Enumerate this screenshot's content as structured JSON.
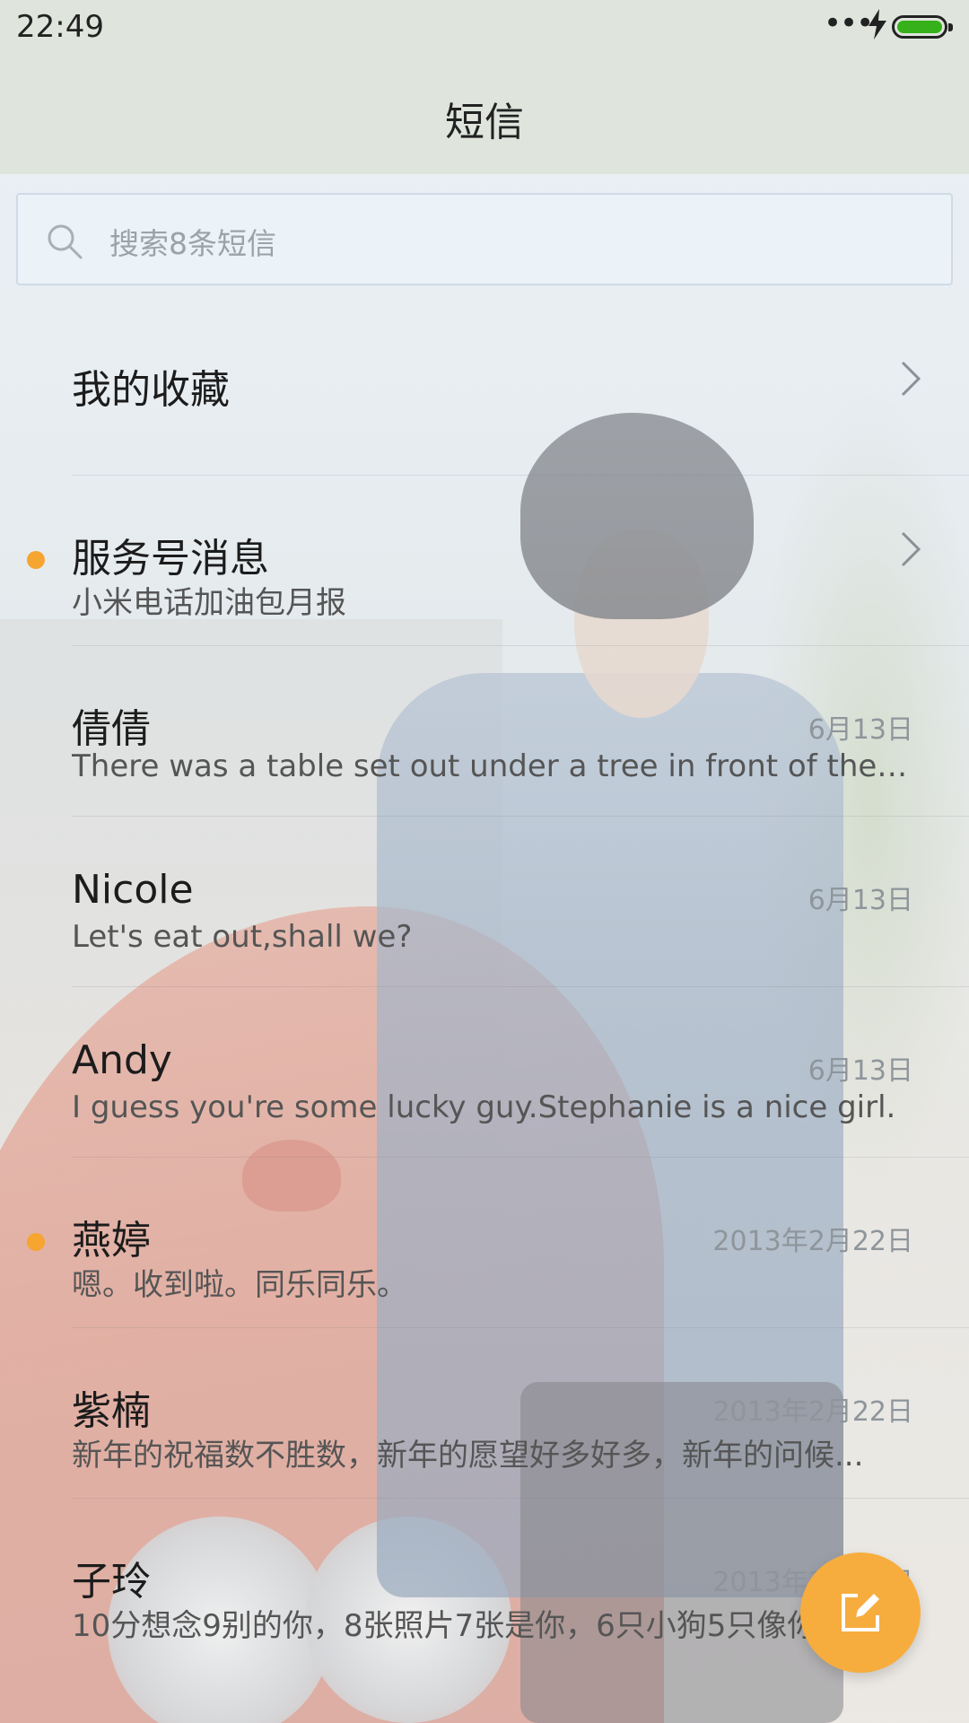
{
  "status_bar": {
    "time": "22:49",
    "signal_dots": "•••",
    "battery_color": "#36b11a"
  },
  "header": {
    "title": "短信"
  },
  "search": {
    "placeholder": "搜索8条短信"
  },
  "favorites": {
    "label": "我的收藏"
  },
  "conversations": [
    {
      "name": "服务号消息",
      "snippet": "小米电话加油包月报",
      "date": "",
      "unread": true,
      "chevron": true
    },
    {
      "name": "倩倩",
      "snippet": "There was a table set out under a tree in front of the ho...",
      "date": "6月13日",
      "unread": false
    },
    {
      "name": "Nicole",
      "snippet": "Let's eat out,shall we?",
      "date": "6月13日",
      "unread": false
    },
    {
      "name": "Andy",
      "snippet": "I guess you're some lucky guy.Stephanie is a nice girl.",
      "date": "6月13日",
      "unread": false
    },
    {
      "name": "燕婷",
      "snippet": "嗯。收到啦。同乐同乐。",
      "date": "2013年2月22日",
      "unread": true
    },
    {
      "name": "紫楠",
      "snippet": "新年的祝福数不胜数，新年的愿望好多好多，新年的问候...",
      "date": "2013年2月22日",
      "unread": false
    },
    {
      "name": "子玲",
      "snippet": "10分想念9别的你，8张照片7张是你，6只小狗5只像你",
      "date": "2013年2月22日",
      "unread": false
    }
  ],
  "accent_color": "#f7ad3e",
  "unread_dot_color": "#f5a530",
  "fab": {
    "icon": "compose-icon"
  }
}
